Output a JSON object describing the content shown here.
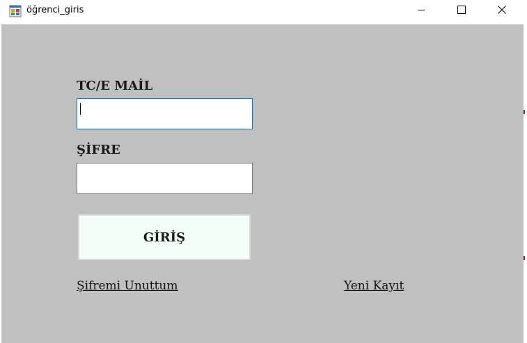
{
  "window": {
    "title": "öğrenci_giris",
    "icon": "winforms-app-icon",
    "controls": {
      "minimize": "minimize-icon",
      "maximize": "maximize-icon",
      "close": "close-icon"
    }
  },
  "form": {
    "tc_email_label": "TC/E MAİL",
    "tc_email_value": "",
    "password_label": "ŞİFRE",
    "password_value": "",
    "login_button": "GİRİŞ",
    "forgot_password_link": "Şifremi Unuttum",
    "register_link": "Yeni Kayıt"
  },
  "colors": {
    "client_background": "#c0c0c0",
    "button_background": "#f5fffa",
    "focus_border": "#0078d7"
  }
}
